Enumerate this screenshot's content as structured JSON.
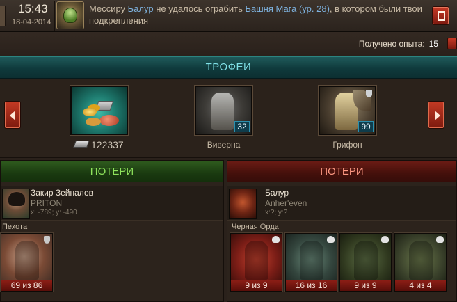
{
  "header": {
    "time": "15:43",
    "date": "18-04-2014",
    "message": {
      "part1": "Мессиру ",
      "player": "Балур",
      "part2": " не удалось ограбить ",
      "target": "Башня Мага (ур. 28)",
      "part3": ", в котором были твои подкрепления"
    }
  },
  "experience": {
    "label": "Получено опыта:",
    "value": "15"
  },
  "trophies": {
    "title": "ТРОФЕИ",
    "resource_amount": "122337",
    "items": [
      {
        "name": "Виверна",
        "count": "32"
      },
      {
        "name": "Грифон",
        "count": "99"
      }
    ]
  },
  "losses_left": {
    "title": "ПОТЕРИ",
    "player_name": "Закир Зейналов",
    "clan": "PRITON",
    "coords": "x: -789; y: -490",
    "faction": "Пехота",
    "units": [
      {
        "name": "archer",
        "qty": "69 из 86"
      }
    ]
  },
  "losses_right": {
    "title": "ПОТЕРИ",
    "player_name": "Балур",
    "clan": "Anher'even",
    "coords": "x:?; y:?",
    "faction": "Черная Орда",
    "units": [
      {
        "name": "bat",
        "qty": "9 из 9"
      },
      {
        "name": "orc-warrior",
        "qty": "16 из 16"
      },
      {
        "name": "orc-brute",
        "qty": "9 из 9"
      },
      {
        "name": "orc-chief",
        "qty": "4 из 4"
      }
    ]
  },
  "icons": [
    "trash-icon",
    "arrow-left-icon",
    "arrow-right-icon",
    "shield-icon",
    "skull-icon",
    "ingot-icon",
    "avatar-icon"
  ]
}
